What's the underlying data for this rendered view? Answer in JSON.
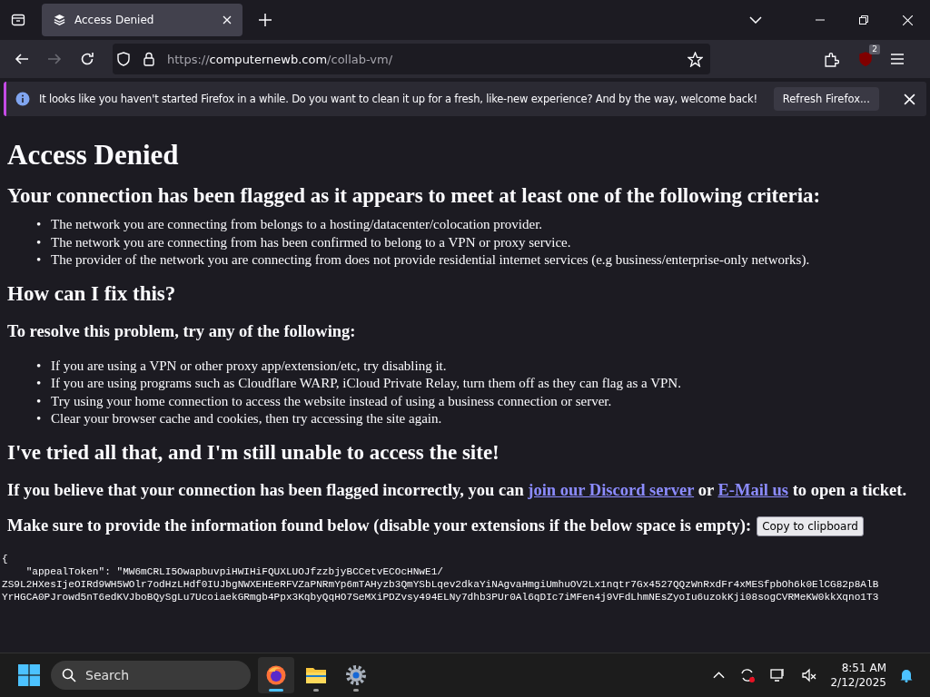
{
  "browser": {
    "tabs": [
      {
        "title": "Access Denied",
        "selected": true
      }
    ],
    "url": {
      "scheme": "https://",
      "host": "computernewb.com",
      "path": "/collab-vm/"
    },
    "extension_badge": "2",
    "notification": {
      "message": "It looks like you haven't started Firefox in a while. Do you want to clean it up for a fresh, like-new experience? And by the way, welcome back!",
      "button": "Refresh Firefox..."
    }
  },
  "page": {
    "blocks": [
      {
        "kind": "h1",
        "text": "Access Denied"
      },
      {
        "kind": "h2",
        "text": "Your connection has been flagged as it appears to meet at least one of the following criteria:"
      },
      {
        "kind": "list",
        "bullet": "•",
        "items": [
          "The network you are connecting from belongs to a hosting/datacenter/colocation provider.",
          "The network you are connecting from has been confirmed to belong to a VPN or proxy service.",
          "The provider of the network you are connecting from does not provide residential internet services (e.g business/enterprise-only networks)."
        ]
      },
      {
        "kind": "h2",
        "text": "How can I fix this?"
      },
      {
        "kind": "h3",
        "text": "To resolve this problem, try any of the following:"
      },
      {
        "kind": "list",
        "bullet": "•",
        "items": [
          "If you are using a VPN or other proxy app/extension/etc, try disabling it.",
          "If you are using programs such as Cloudflare WARP, iCloud Private Relay, turn them off as they can flag as a VPN.",
          "Try using your home connection to access the website instead of using a business connection or server.",
          "Clear your browser cache and cookies, then try accessing the site again."
        ]
      },
      {
        "kind": "h2",
        "text": "I've tried all that, and I'm still unable to access the site!"
      },
      {
        "kind": "h3links",
        "parts": [
          {
            "text": "If you believe that your connection has been flagged incorrectly, you can "
          },
          {
            "text": "join our Discord server",
            "link": true
          },
          {
            "text": " or "
          },
          {
            "text": "E-Mail us",
            "link": true
          },
          {
            "text": " to open a ticket."
          }
        ]
      },
      {
        "kind": "h3button",
        "text": "Make sure to provide the information found below (disable your extensions if the below space is empty):",
        "button": "Copy to clipboard"
      }
    ],
    "json_output": [
      "{",
      "    \"appealToken\": \"MW6mCRLI5OwapbuvpiHWIHiFQUXLUOJfzzbjyBCCetvECOcHNwE1/",
      "ZS9L2HXesIjeOIRd9WH5WOlr7odHzLHdf0IUJbgNWXEHEeRFVZaPNRmYp6mTAHyzb3QmYSbLqev2dkaYiNAgvaHmgiUmhuOV2Lx1nqtr7Gx4527QQzWnRxdFr4xMESfpbOh6k0ElCG82p8AlB",
      "YrHGCA0PJrowd5nT6edKVJboBQySgLu7UcoiaekGRmgb4Ppx3KqbyQqHO7SeMXiPDZvsy494ELNy7dhb3PUr0Al6qDIc7iMFen4j9VFdLhmNEsZyoIu6uzokKji08sogCVRMeKW0kkXqno1T3"
    ]
  },
  "taskbar": {
    "search_placeholder": "Search",
    "apps": [
      {
        "kind": "firefox",
        "selected": true
      },
      {
        "kind": "folder",
        "selected": false
      },
      {
        "kind": "settings",
        "selected": false
      }
    ],
    "time": "8:51 AM",
    "date": "2/12/2025"
  }
}
